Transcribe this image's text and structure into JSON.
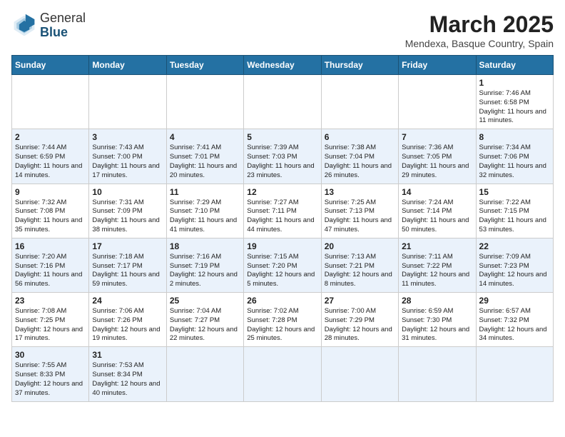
{
  "header": {
    "logo_general": "General",
    "logo_blue": "Blue",
    "month": "March 2025",
    "location": "Mendexa, Basque Country, Spain"
  },
  "days_of_week": [
    "Sunday",
    "Monday",
    "Tuesday",
    "Wednesday",
    "Thursday",
    "Friday",
    "Saturday"
  ],
  "weeks": [
    [
      {
        "day": "",
        "content": ""
      },
      {
        "day": "",
        "content": ""
      },
      {
        "day": "",
        "content": ""
      },
      {
        "day": "",
        "content": ""
      },
      {
        "day": "",
        "content": ""
      },
      {
        "day": "",
        "content": ""
      },
      {
        "day": "1",
        "content": "Sunrise: 7:46 AM\nSunset: 6:58 PM\nDaylight: 11 hours and 11 minutes."
      }
    ],
    [
      {
        "day": "2",
        "content": "Sunrise: 7:44 AM\nSunset: 6:59 PM\nDaylight: 11 hours and 14 minutes."
      },
      {
        "day": "3",
        "content": "Sunrise: 7:43 AM\nSunset: 7:00 PM\nDaylight: 11 hours and 17 minutes."
      },
      {
        "day": "4",
        "content": "Sunrise: 7:41 AM\nSunset: 7:01 PM\nDaylight: 11 hours and 20 minutes."
      },
      {
        "day": "5",
        "content": "Sunrise: 7:39 AM\nSunset: 7:03 PM\nDaylight: 11 hours and 23 minutes."
      },
      {
        "day": "6",
        "content": "Sunrise: 7:38 AM\nSunset: 7:04 PM\nDaylight: 11 hours and 26 minutes."
      },
      {
        "day": "7",
        "content": "Sunrise: 7:36 AM\nSunset: 7:05 PM\nDaylight: 11 hours and 29 minutes."
      },
      {
        "day": "8",
        "content": "Sunrise: 7:34 AM\nSunset: 7:06 PM\nDaylight: 11 hours and 32 minutes."
      }
    ],
    [
      {
        "day": "9",
        "content": "Sunrise: 7:32 AM\nSunset: 7:08 PM\nDaylight: 11 hours and 35 minutes."
      },
      {
        "day": "10",
        "content": "Sunrise: 7:31 AM\nSunset: 7:09 PM\nDaylight: 11 hours and 38 minutes."
      },
      {
        "day": "11",
        "content": "Sunrise: 7:29 AM\nSunset: 7:10 PM\nDaylight: 11 hours and 41 minutes."
      },
      {
        "day": "12",
        "content": "Sunrise: 7:27 AM\nSunset: 7:11 PM\nDaylight: 11 hours and 44 minutes."
      },
      {
        "day": "13",
        "content": "Sunrise: 7:25 AM\nSunset: 7:13 PM\nDaylight: 11 hours and 47 minutes."
      },
      {
        "day": "14",
        "content": "Sunrise: 7:24 AM\nSunset: 7:14 PM\nDaylight: 11 hours and 50 minutes."
      },
      {
        "day": "15",
        "content": "Sunrise: 7:22 AM\nSunset: 7:15 PM\nDaylight: 11 hours and 53 minutes."
      }
    ],
    [
      {
        "day": "16",
        "content": "Sunrise: 7:20 AM\nSunset: 7:16 PM\nDaylight: 11 hours and 56 minutes."
      },
      {
        "day": "17",
        "content": "Sunrise: 7:18 AM\nSunset: 7:17 PM\nDaylight: 11 hours and 59 minutes."
      },
      {
        "day": "18",
        "content": "Sunrise: 7:16 AM\nSunset: 7:19 PM\nDaylight: 12 hours and 2 minutes."
      },
      {
        "day": "19",
        "content": "Sunrise: 7:15 AM\nSunset: 7:20 PM\nDaylight: 12 hours and 5 minutes."
      },
      {
        "day": "20",
        "content": "Sunrise: 7:13 AM\nSunset: 7:21 PM\nDaylight: 12 hours and 8 minutes."
      },
      {
        "day": "21",
        "content": "Sunrise: 7:11 AM\nSunset: 7:22 PM\nDaylight: 12 hours and 11 minutes."
      },
      {
        "day": "22",
        "content": "Sunrise: 7:09 AM\nSunset: 7:23 PM\nDaylight: 12 hours and 14 minutes."
      }
    ],
    [
      {
        "day": "23",
        "content": "Sunrise: 7:08 AM\nSunset: 7:25 PM\nDaylight: 12 hours and 17 minutes."
      },
      {
        "day": "24",
        "content": "Sunrise: 7:06 AM\nSunset: 7:26 PM\nDaylight: 12 hours and 19 minutes."
      },
      {
        "day": "25",
        "content": "Sunrise: 7:04 AM\nSunset: 7:27 PM\nDaylight: 12 hours and 22 minutes."
      },
      {
        "day": "26",
        "content": "Sunrise: 7:02 AM\nSunset: 7:28 PM\nDaylight: 12 hours and 25 minutes."
      },
      {
        "day": "27",
        "content": "Sunrise: 7:00 AM\nSunset: 7:29 PM\nDaylight: 12 hours and 28 minutes."
      },
      {
        "day": "28",
        "content": "Sunrise: 6:59 AM\nSunset: 7:30 PM\nDaylight: 12 hours and 31 minutes."
      },
      {
        "day": "29",
        "content": "Sunrise: 6:57 AM\nSunset: 7:32 PM\nDaylight: 12 hours and 34 minutes."
      }
    ],
    [
      {
        "day": "30",
        "content": "Sunrise: 7:55 AM\nSunset: 8:33 PM\nDaylight: 12 hours and 37 minutes."
      },
      {
        "day": "31",
        "content": "Sunrise: 7:53 AM\nSunset: 8:34 PM\nDaylight: 12 hours and 40 minutes."
      },
      {
        "day": "",
        "content": ""
      },
      {
        "day": "",
        "content": ""
      },
      {
        "day": "",
        "content": ""
      },
      {
        "day": "",
        "content": ""
      },
      {
        "day": "",
        "content": ""
      }
    ]
  ]
}
